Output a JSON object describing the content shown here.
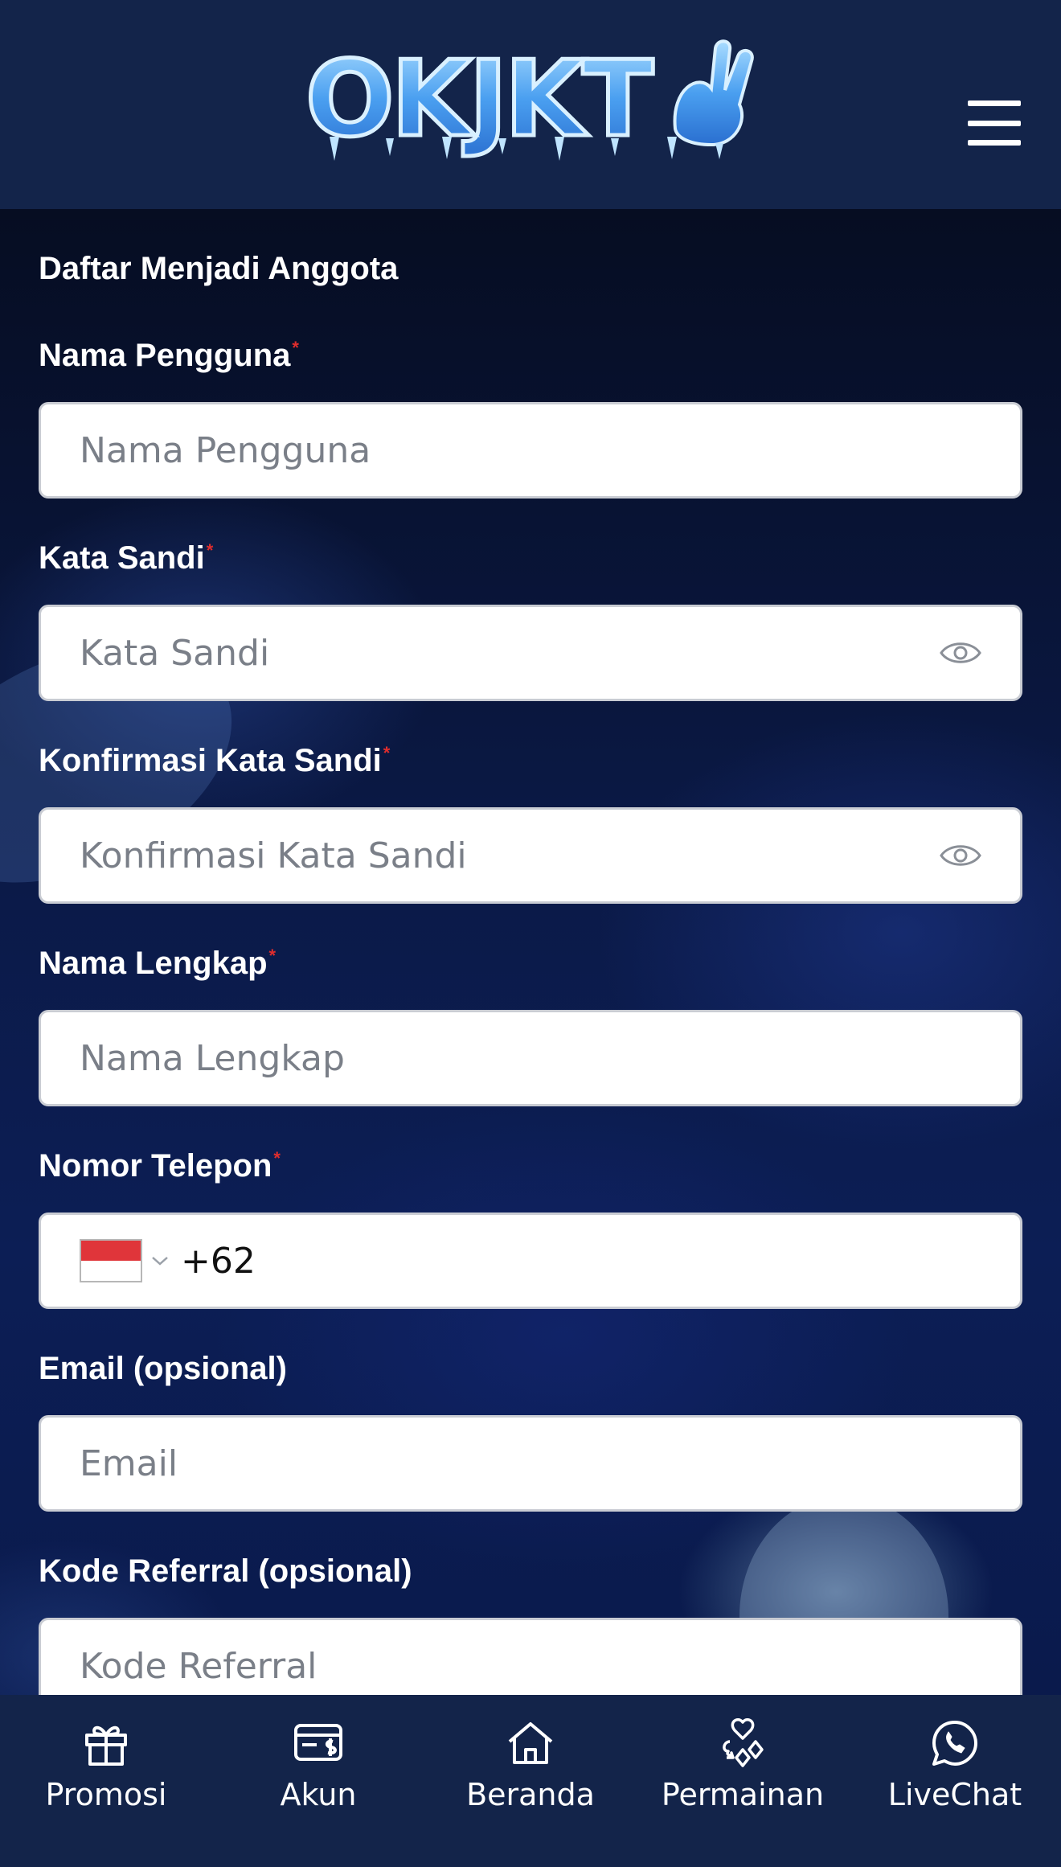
{
  "header": {
    "logo_text": "OKJKT",
    "menu_icon": "hamburger-menu-icon"
  },
  "form": {
    "title": "Daftar Menjadi Anggota",
    "required_mark": "*",
    "fields": {
      "username": {
        "label": "Nama Pengguna",
        "placeholder": "Nama Pengguna"
      },
      "password": {
        "label": "Kata Sandi",
        "placeholder": "Kata Sandi"
      },
      "confirm_password": {
        "label": "Konfirmasi Kata Sandi",
        "placeholder": "Konfirmasi Kata Sandi"
      },
      "full_name": {
        "label": "Nama Lengkap",
        "placeholder": "Nama Lengkap"
      },
      "phone": {
        "label": "Nomor Telepon",
        "country_code": "+62",
        "flag": "indonesia-flag-icon"
      },
      "email": {
        "label": "Email (opsional)",
        "placeholder": "Email"
      },
      "referral": {
        "label": "Kode Referral (opsional)",
        "placeholder": "Kode Referral"
      }
    }
  },
  "bottom_nav": {
    "items": [
      {
        "label": "Promosi",
        "icon": "gift-icon"
      },
      {
        "label": "Akun",
        "icon": "wallet-card-icon"
      },
      {
        "label": "Beranda",
        "icon": "home-icon"
      },
      {
        "label": "Permainan",
        "icon": "card-suits-icon"
      },
      {
        "label": "LiveChat",
        "icon": "whatsapp-chat-icon"
      }
    ]
  },
  "colors": {
    "header_bg": "#13244a",
    "page_bg": "#050b1c",
    "required": "#e02d2d",
    "logo_blue": "#5aa8f0"
  }
}
